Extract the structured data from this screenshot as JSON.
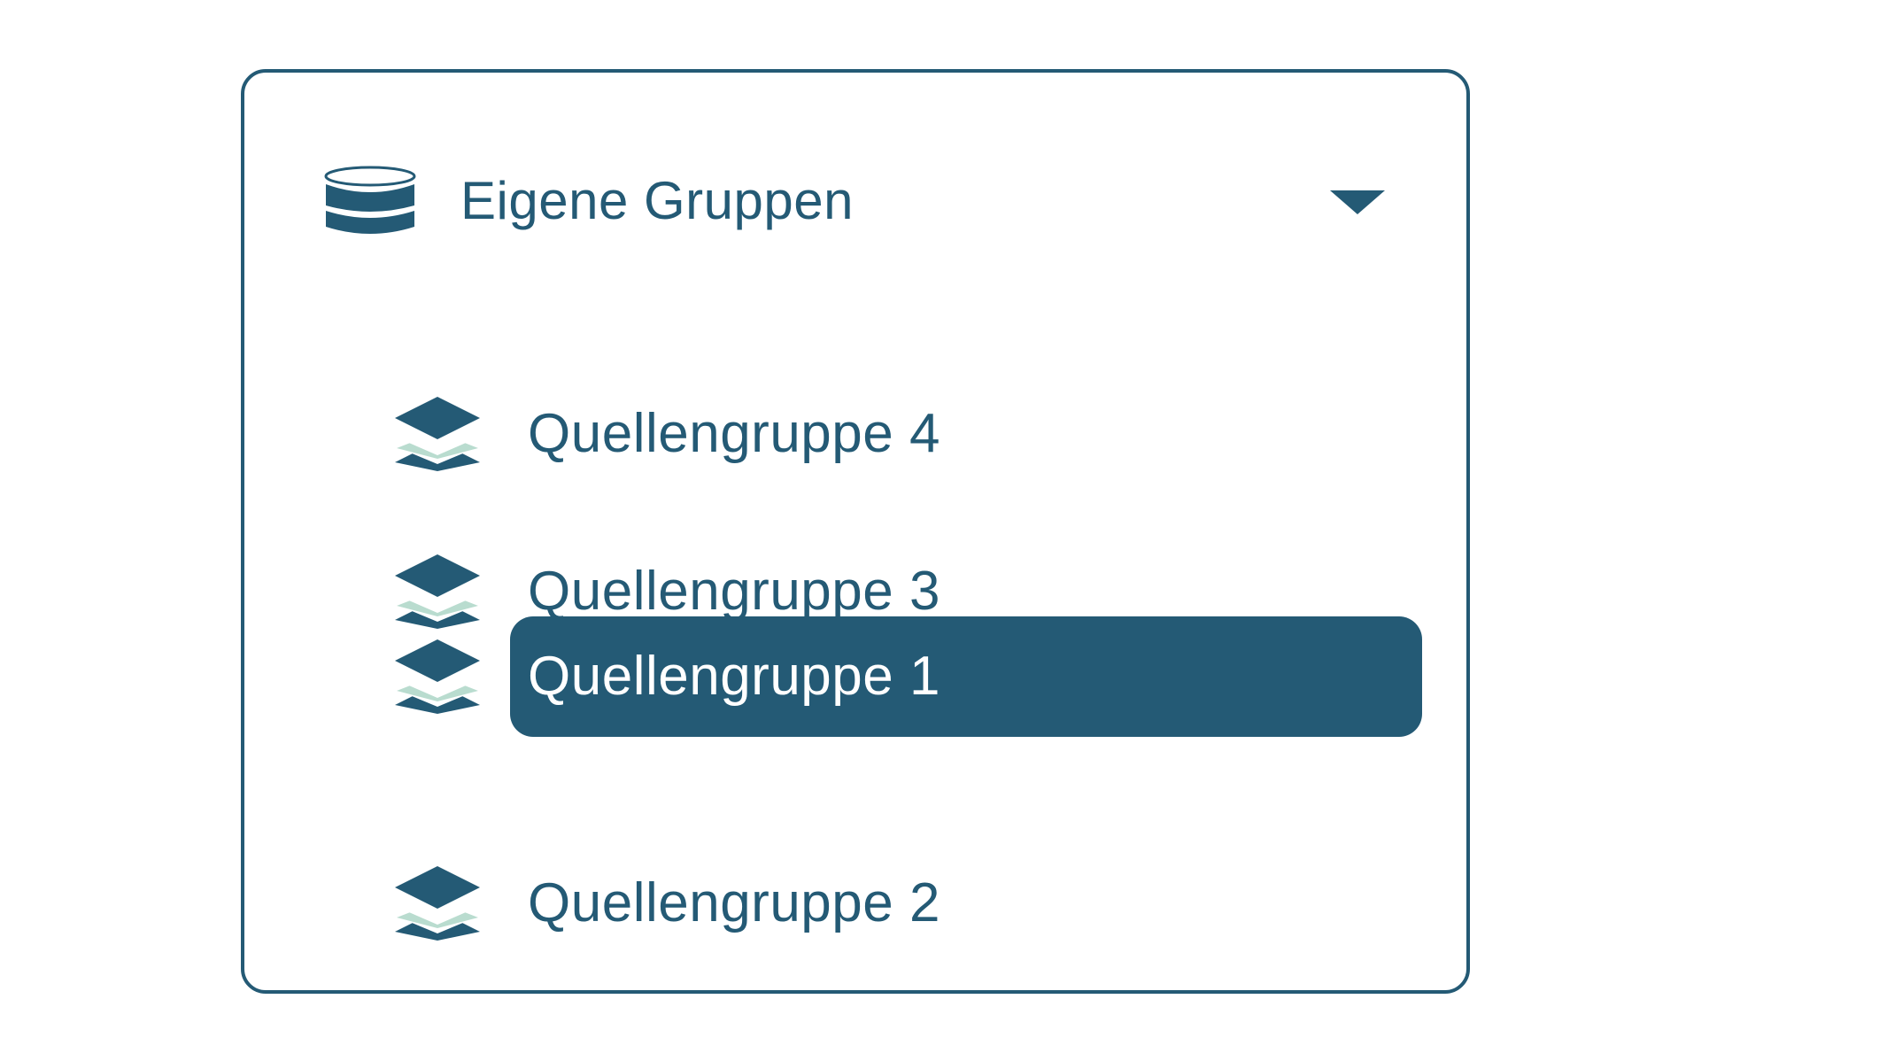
{
  "dropdown": {
    "header": {
      "title": "Eigene Gruppen",
      "icon": "database-icon",
      "toggle_icon": "chevron-down-icon"
    },
    "items": [
      {
        "label": "Quellengruppe 4",
        "icon": "layers-icon",
        "selected": false
      },
      {
        "label": "Quellengruppe 3",
        "icon": "layers-icon",
        "selected": false
      },
      {
        "label": "Quellengruppe 1",
        "icon": "layers-icon",
        "selected": true
      },
      {
        "label": "Quellengruppe 2",
        "icon": "layers-icon",
        "selected": false
      }
    ]
  },
  "colors": {
    "primary": "#245a75",
    "accent_light": "#b9dccf",
    "background": "#ffffff",
    "selected_text": "#ffffff"
  }
}
